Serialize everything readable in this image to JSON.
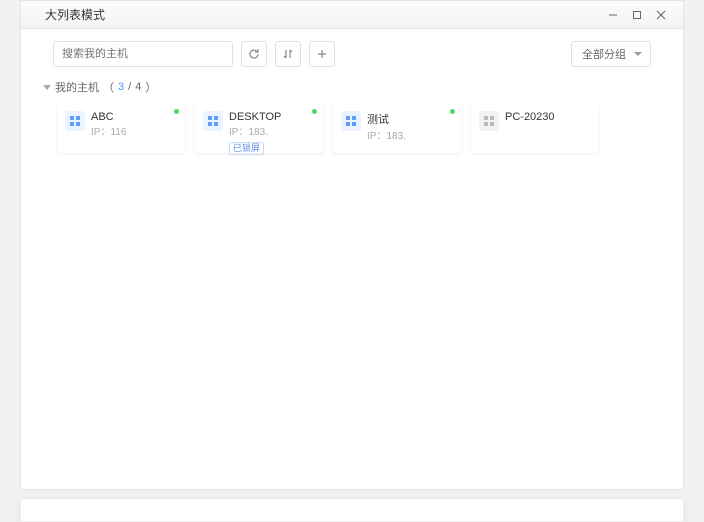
{
  "title": "大列表模式",
  "search": {
    "placeholder": "搜索我的主机"
  },
  "dropdown": {
    "label": "全部分组"
  },
  "group": {
    "label": "我的主机",
    "online": "3",
    "separator": "/",
    "total": "4"
  },
  "hosts": [
    {
      "name": "ABC",
      "ip": "IP：116",
      "online": true
    },
    {
      "name": "DESKTOP",
      "ip": "IP：183.",
      "online": true,
      "badge": "已锁屏"
    },
    {
      "name": "测试",
      "ip": "IP：183.",
      "online": true
    },
    {
      "name": "PC-20230",
      "ip": "",
      "online": false
    }
  ]
}
